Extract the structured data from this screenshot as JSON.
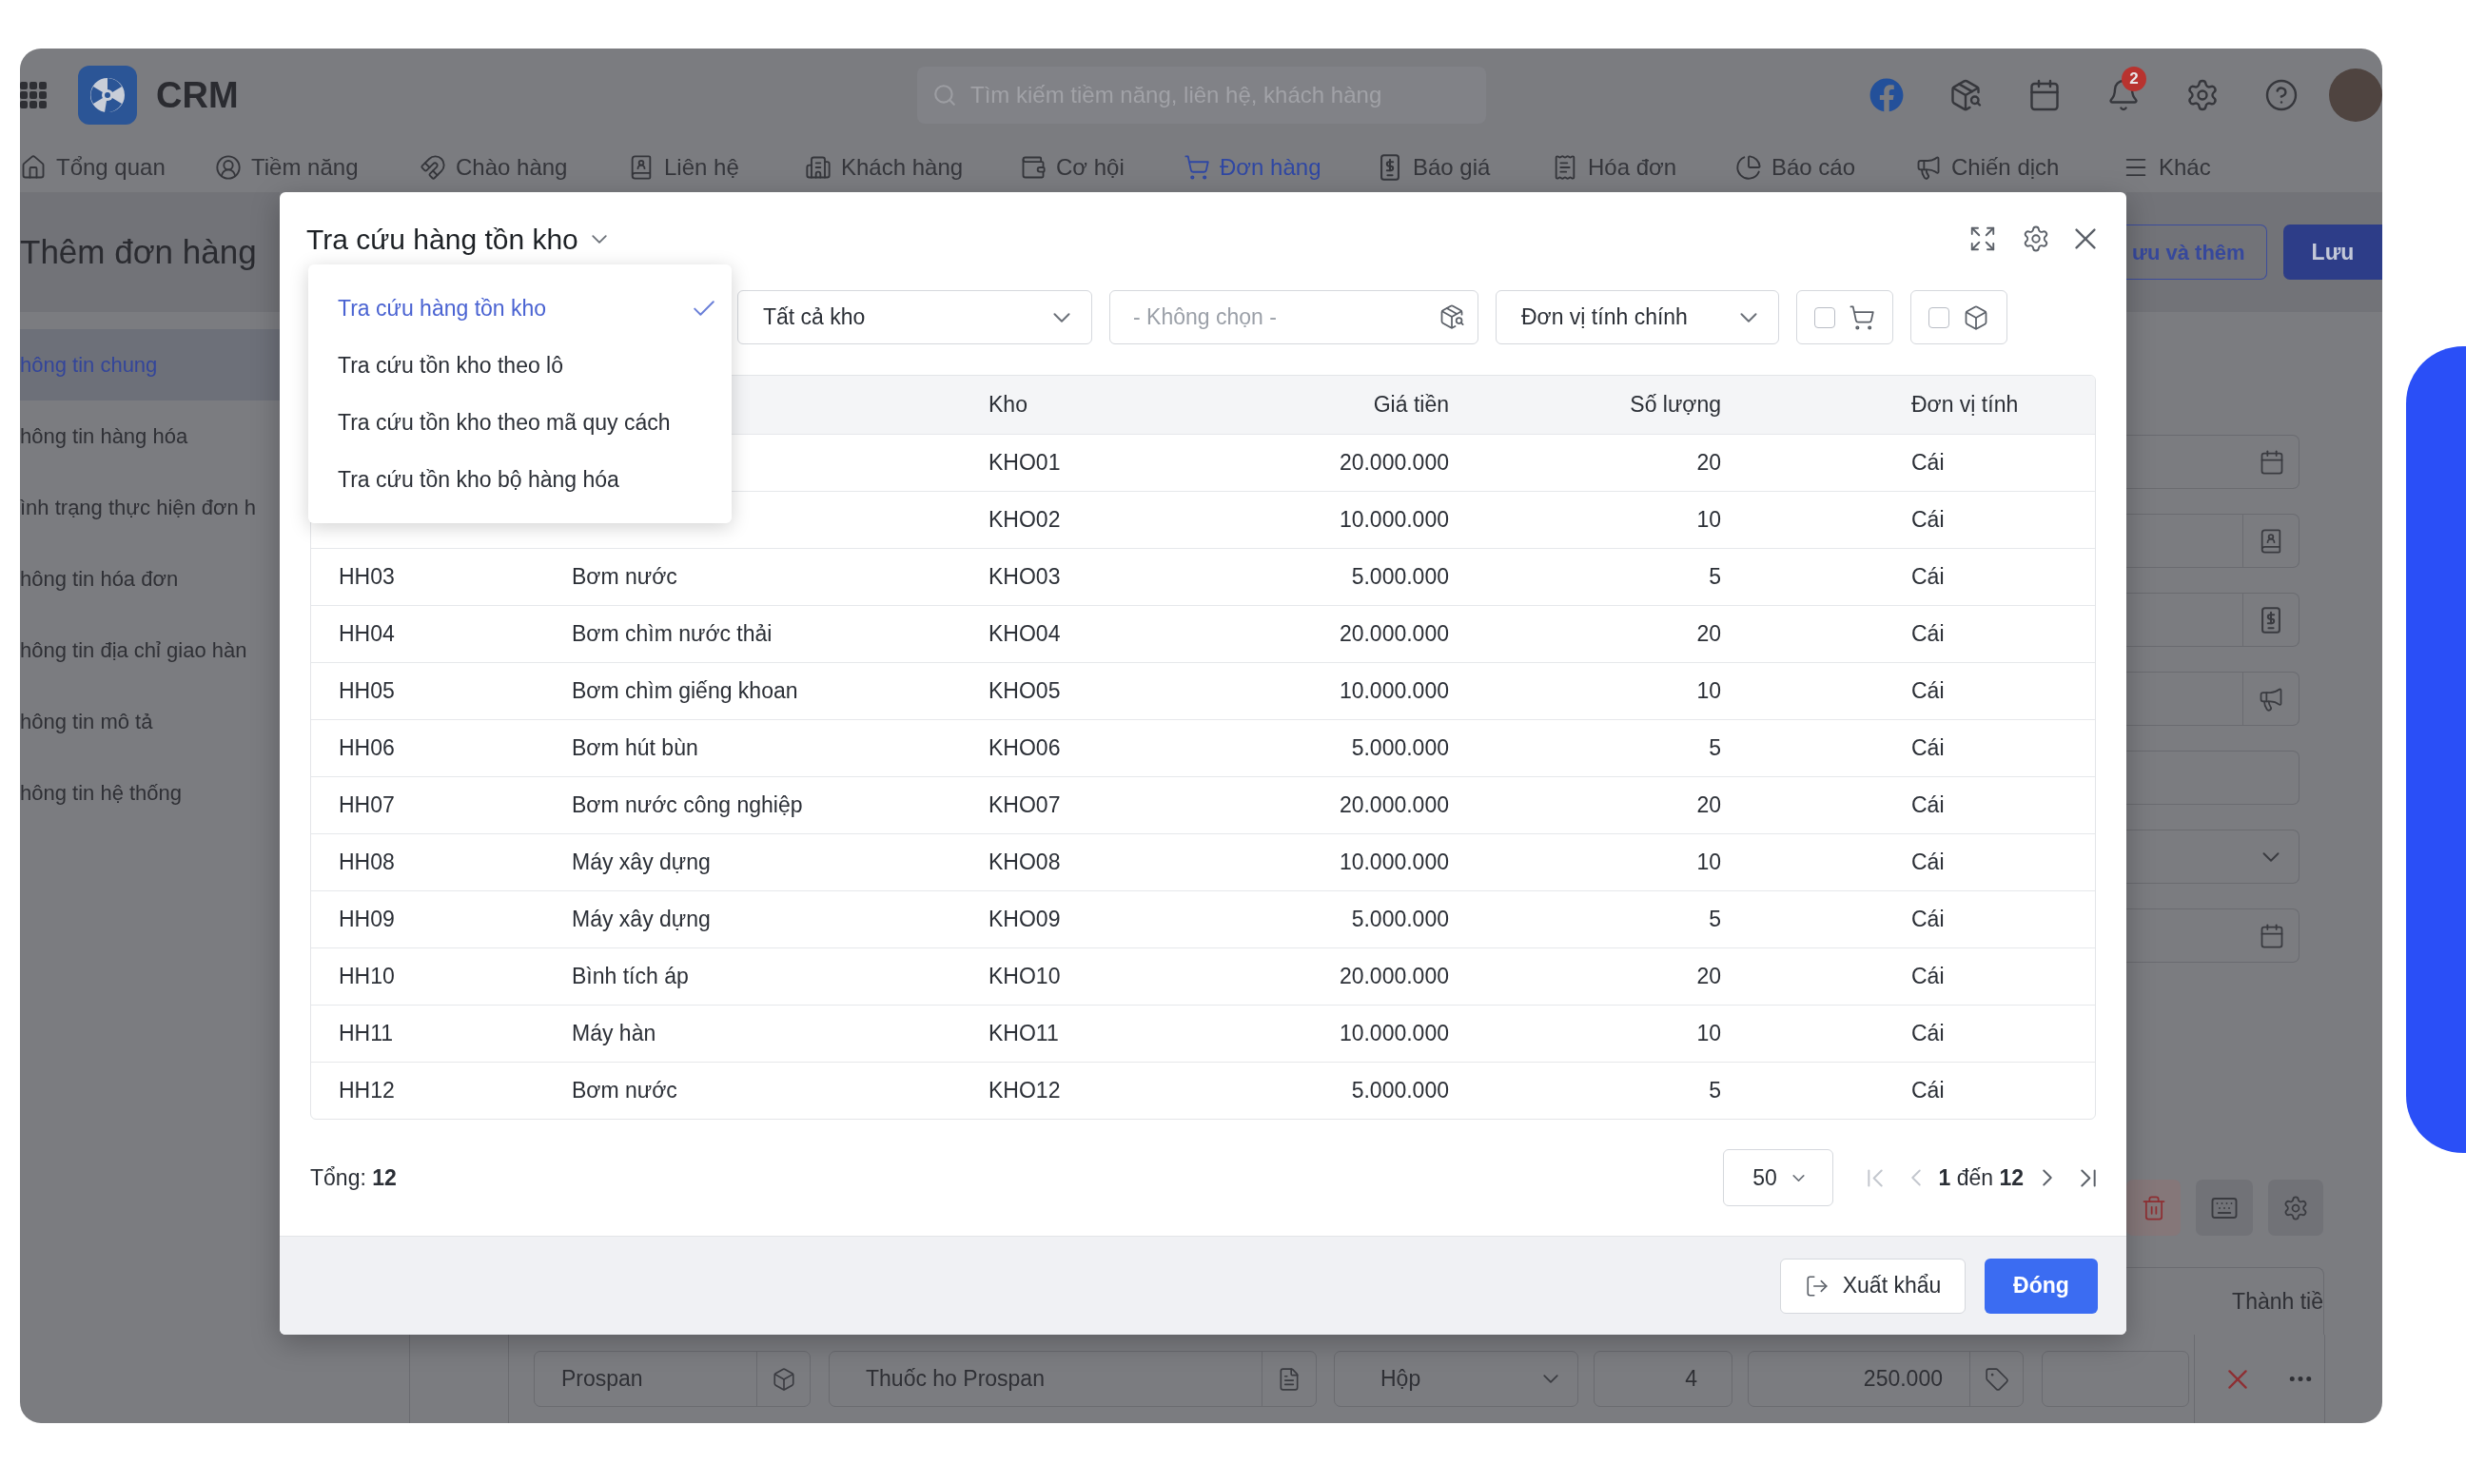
{
  "app": {
    "name": "CRM",
    "search": {
      "placeholder": "Tìm kiếm tiềm năng, liên hệ, khách hàng"
    },
    "notification_count": "2"
  },
  "nav": [
    {
      "label": "Tổng quan",
      "selected": false
    },
    {
      "label": "Tiềm năng",
      "selected": false
    },
    {
      "label": "Chào hàng",
      "selected": false
    },
    {
      "label": "Liên hệ",
      "selected": false
    },
    {
      "label": "Khách hàng",
      "selected": false
    },
    {
      "label": "Cơ hội",
      "selected": false
    },
    {
      "label": "Đơn hàng",
      "selected": true
    },
    {
      "label": "Báo giá",
      "selected": false
    },
    {
      "label": "Hóa đơn",
      "selected": false
    },
    {
      "label": "Báo cáo",
      "selected": false
    },
    {
      "label": "Chiến dịch",
      "selected": false
    },
    {
      "label": "Khác",
      "selected": false
    }
  ],
  "page": {
    "title": "Thêm đơn hàng",
    "sections": [
      {
        "label": "hông tin chung",
        "selected": true
      },
      {
        "label": "hông tin hàng hóa",
        "selected": false
      },
      {
        "label": "ình trạng thực hiện đơn h",
        "selected": false
      },
      {
        "label": "hông tin hóa đơn",
        "selected": false
      },
      {
        "label": "hông tin địa chỉ giao hàn",
        "selected": false
      },
      {
        "label": "hông tin mô tả",
        "selected": false
      },
      {
        "label": "hông tin hệ thống",
        "selected": false
      }
    ],
    "actions": [
      {
        "label": "ưu và thêm",
        "kind": "secondary"
      },
      {
        "label": "Lưu",
        "kind": "primary"
      }
    ],
    "fields": [
      {
        "kind": "date"
      },
      {
        "kind": "contact"
      },
      {
        "kind": "quote"
      },
      {
        "kind": "campaign"
      },
      {
        "kind": "text"
      },
      {
        "kind": "select"
      },
      {
        "kind": "date"
      }
    ],
    "items_table": {
      "column_heading": "Thành tiề",
      "row": [
        "Prospan",
        "Thuốc ho Prospan",
        "Hộp",
        "4",
        "250.000"
      ]
    }
  },
  "dialog": {
    "title": "Tra cứu hàng tồn kho",
    "view_menu": [
      {
        "label": "Tra cứu hàng tồn kho",
        "selected": true
      },
      {
        "label": "Tra cứu tồn kho theo lô",
        "selected": false
      },
      {
        "label": "Tra cứu tồn kho theo mã quy cách",
        "selected": false
      },
      {
        "label": "Tra cứu tồn kho bộ hàng hóa",
        "selected": false
      }
    ],
    "filters": [
      {
        "kind": "select",
        "value": "Tất cả kho"
      },
      {
        "kind": "lookup",
        "placeholder": "- Không chọn -"
      },
      {
        "kind": "select",
        "value": "Đơn vị tính chính"
      },
      {
        "kind": "cart_toggle",
        "checked": false
      },
      {
        "kind": "box_toggle",
        "checked": false
      }
    ],
    "table": {
      "headings": {
        "kho": "Kho",
        "gia_tien": "Giá tiền",
        "so_luong": "Số lượng",
        "don_vi_tinh": "Đơn vị tính"
      },
      "rows": [
        {
          "kho": "KHO01",
          "gia_tien": "20.000.000",
          "so_luong": "20",
          "don_vi_tinh": "Cái"
        },
        {
          "kho": "KHO02",
          "gia_tien": "10.000.000",
          "so_luong": "10",
          "don_vi_tinh": "Cái"
        },
        {
          "column_1": "HH03",
          "column_2": "Bơm nước",
          "kho": "KHO03",
          "gia_tien": "5.000.000",
          "so_luong": "5",
          "don_vi_tinh": "Cái"
        },
        {
          "column_1": "HH04",
          "column_2": "Bơm chìm nước thải",
          "kho": "KHO04",
          "gia_tien": "20.000.000",
          "so_luong": "20",
          "don_vi_tinh": "Cái"
        },
        {
          "column_1": "HH05",
          "column_2": "Bơm chìm giếng khoan",
          "kho": "KHO05",
          "gia_tien": "10.000.000",
          "so_luong": "10",
          "don_vi_tinh": "Cái"
        },
        {
          "column_1": "HH06",
          "column_2": "Bơm hút bùn",
          "kho": "KHO06",
          "gia_tien": "5.000.000",
          "so_luong": "5",
          "don_vi_tinh": "Cái"
        },
        {
          "column_1": "HH07",
          "column_2": "Bơm nước công nghiệp",
          "kho": "KHO07",
          "gia_tien": "20.000.000",
          "so_luong": "20",
          "don_vi_tinh": "Cái"
        },
        {
          "column_1": "HH08",
          "column_2": "Máy xây dựng",
          "kho": "KHO08",
          "gia_tien": "10.000.000",
          "so_luong": "10",
          "don_vi_tinh": "Cái"
        },
        {
          "column_1": "HH09",
          "column_2": "Máy xây dựng",
          "kho": "KHO09",
          "gia_tien": "5.000.000",
          "so_luong": "5",
          "don_vi_tinh": "Cái"
        },
        {
          "column_1": "HH10",
          "column_2": "Bình tích áp",
          "kho": "KHO10",
          "gia_tien": "20.000.000",
          "so_luong": "20",
          "don_vi_tinh": "Cái"
        },
        {
          "column_1": "HH11",
          "column_2": "Máy hàn",
          "kho": "KHO11",
          "gia_tien": "10.000.000",
          "so_luong": "10",
          "don_vi_tinh": "Cái"
        },
        {
          "column_1": "HH12",
          "column_2": "Bơm nước",
          "kho": "KHO12",
          "gia_tien": "5.000.000",
          "so_luong": "5",
          "don_vi_tinh": "Cái"
        }
      ]
    },
    "footer": {
      "total": "Tổng: **12**",
      "page_size": "50",
      "range": "**1** đến **12**"
    },
    "buttons": [
      {
        "label": "Xuất khẩu",
        "kind": "export"
      },
      {
        "label": "Đóng",
        "kind": "primary"
      }
    ]
  }
}
